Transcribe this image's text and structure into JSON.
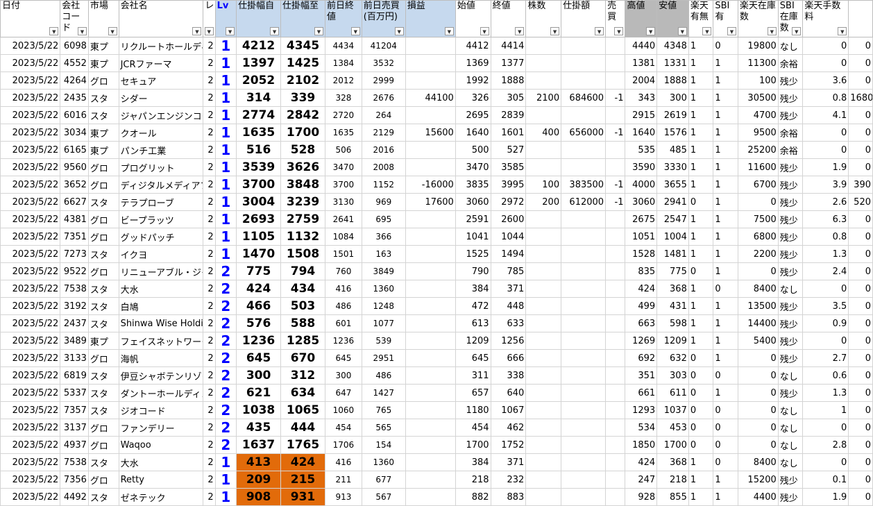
{
  "headers": [
    "日付",
    "会社コード",
    "市場",
    "会社名",
    "レ",
    "Lv",
    "仕掛幅自",
    "仕掛幅至",
    "前日終値",
    "前日売買(百万円)",
    "損益",
    "始値",
    "終値",
    "株数",
    "仕掛額",
    "売買",
    "高値",
    "安値",
    "楽天有無",
    "SBI有",
    "楽天在庫数",
    "SBI在庫数",
    "楽天手数料",
    ""
  ],
  "highlight": {
    "blue": [
      5,
      6,
      7,
      8,
      9,
      10
    ],
    "grey": [
      16,
      17
    ]
  },
  "colors": {
    "lv": "#0000ff",
    "orange": "#e26b0a",
    "header_blue": "#c6d9ee",
    "header_grey": "#b9b9b9",
    "grid": "#d4d4d4"
  },
  "rows": [
    [
      "2023/5/22",
      "6098",
      "東プ",
      "リクルートホールディングス",
      "2",
      "1",
      "4212",
      "4345",
      "4434",
      "41204",
      "",
      "4412",
      "4414",
      "",
      "",
      "",
      "4440",
      "4348",
      "1",
      "0",
      "19800",
      "なし",
      "0",
      "0"
    ],
    [
      "2023/5/22",
      "4552",
      "東プ",
      "JCRファーマ",
      "2",
      "1",
      "1397",
      "1425",
      "1384",
      "3532",
      "",
      "1369",
      "1377",
      "",
      "",
      "",
      "1381",
      "1331",
      "1",
      "1",
      "11300",
      "余裕",
      "0",
      "0"
    ],
    [
      "2023/5/22",
      "4264",
      "グロ",
      "セキュア",
      "2",
      "1",
      "2052",
      "2102",
      "2012",
      "2999",
      "",
      "1992",
      "1888",
      "",
      "",
      "",
      "2004",
      "1888",
      "1",
      "1",
      "100",
      "残少",
      "3.6",
      "0"
    ],
    [
      "2023/5/22",
      "2435",
      "スタ",
      "シダー",
      "2",
      "1",
      "314",
      "339",
      "328",
      "2676",
      "44100",
      "326",
      "305",
      "2100",
      "684600",
      "-1",
      "343",
      "300",
      "1",
      "1",
      "30500",
      "残少",
      "0.8",
      "1680"
    ],
    [
      "2023/5/22",
      "6016",
      "スタ",
      "ジャパンエンジンコーポレーション",
      "2",
      "1",
      "2774",
      "2842",
      "2720",
      "264",
      "",
      "2695",
      "2839",
      "",
      "",
      "",
      "2915",
      "2619",
      "1",
      "1",
      "4700",
      "残少",
      "4.1",
      "0"
    ],
    [
      "2023/5/22",
      "3034",
      "東プ",
      "クオール",
      "2",
      "1",
      "1635",
      "1700",
      "1635",
      "2129",
      "15600",
      "1640",
      "1601",
      "400",
      "656000",
      "-1",
      "1640",
      "1576",
      "1",
      "1",
      "9500",
      "余裕",
      "0",
      "0"
    ],
    [
      "2023/5/22",
      "6165",
      "東プ",
      "パンチ工業",
      "2",
      "1",
      "516",
      "528",
      "506",
      "2016",
      "",
      "500",
      "527",
      "",
      "",
      "",
      "535",
      "485",
      "1",
      "1",
      "25200",
      "余裕",
      "0",
      "0"
    ],
    [
      "2023/5/22",
      "9560",
      "グロ",
      "プログリット",
      "2",
      "1",
      "3539",
      "3626",
      "3470",
      "2008",
      "",
      "3470",
      "3585",
      "",
      "",
      "",
      "3590",
      "3330",
      "1",
      "1",
      "11600",
      "残少",
      "1.9",
      "0"
    ],
    [
      "2023/5/22",
      "3652",
      "グロ",
      "ディジタルメディアプロフェッショナル",
      "2",
      "1",
      "3700",
      "3848",
      "3700",
      "1152",
      "-16000",
      "3835",
      "3995",
      "100",
      "383500",
      "-1",
      "4000",
      "3655",
      "1",
      "1",
      "6700",
      "残少",
      "3.9",
      "390"
    ],
    [
      "2023/5/22",
      "6627",
      "スタ",
      "テラプローブ",
      "2",
      "1",
      "3004",
      "3239",
      "3130",
      "969",
      "17600",
      "3060",
      "2972",
      "200",
      "612000",
      "-1",
      "3060",
      "2941",
      "0",
      "1",
      "0",
      "残少",
      "2.6",
      "520"
    ],
    [
      "2023/5/22",
      "4381",
      "グロ",
      "ビープラッツ",
      "2",
      "1",
      "2693",
      "2759",
      "2641",
      "695",
      "",
      "2591",
      "2600",
      "",
      "",
      "",
      "2675",
      "2547",
      "1",
      "1",
      "7500",
      "残少",
      "6.3",
      "0"
    ],
    [
      "2023/5/22",
      "7351",
      "グロ",
      "グッドパッチ",
      "2",
      "1",
      "1105",
      "1132",
      "1084",
      "366",
      "",
      "1041",
      "1044",
      "",
      "",
      "",
      "1051",
      "1004",
      "1",
      "1",
      "6800",
      "残少",
      "0.8",
      "0"
    ],
    [
      "2023/5/22",
      "7273",
      "スタ",
      "イクヨ",
      "2",
      "1",
      "1470",
      "1508",
      "1501",
      "163",
      "",
      "1525",
      "1494",
      "",
      "",
      "",
      "1528",
      "1481",
      "1",
      "1",
      "2200",
      "残少",
      "1.3",
      "0"
    ],
    [
      "2023/5/22",
      "9522",
      "グロ",
      "リニューアブル・ジャパン",
      "2",
      "2",
      "775",
      "794",
      "760",
      "3849",
      "",
      "790",
      "785",
      "",
      "",
      "",
      "835",
      "775",
      "0",
      "1",
      "0",
      "残少",
      "2.4",
      "0"
    ],
    [
      "2023/5/22",
      "7538",
      "スタ",
      "大水",
      "2",
      "2",
      "424",
      "434",
      "416",
      "1360",
      "",
      "384",
      "371",
      "",
      "",
      "",
      "424",
      "368",
      "1",
      "0",
      "8400",
      "なし",
      "0",
      "0"
    ],
    [
      "2023/5/22",
      "3192",
      "スタ",
      "白鳩",
      "2",
      "2",
      "466",
      "503",
      "486",
      "1248",
      "",
      "472",
      "448",
      "",
      "",
      "",
      "499",
      "431",
      "1",
      "1",
      "13500",
      "残少",
      "3.5",
      "0"
    ],
    [
      "2023/5/22",
      "2437",
      "スタ",
      "Shinwa Wise Holdings",
      "2",
      "2",
      "576",
      "588",
      "601",
      "1077",
      "",
      "613",
      "633",
      "",
      "",
      "",
      "663",
      "598",
      "1",
      "1",
      "14400",
      "残少",
      "0.9",
      "0"
    ],
    [
      "2023/5/22",
      "3489",
      "東プ",
      "フェイスネットワーク",
      "2",
      "2",
      "1236",
      "1285",
      "1236",
      "539",
      "",
      "1209",
      "1256",
      "",
      "",
      "",
      "1269",
      "1209",
      "1",
      "1",
      "5400",
      "残少",
      "0",
      "0"
    ],
    [
      "2023/5/22",
      "3133",
      "グロ",
      "海帆",
      "2",
      "2",
      "645",
      "670",
      "645",
      "2951",
      "",
      "645",
      "666",
      "",
      "",
      "",
      "692",
      "632",
      "0",
      "1",
      "0",
      "残少",
      "2.7",
      "0"
    ],
    [
      "2023/5/22",
      "6819",
      "スタ",
      "伊豆シャボテンリゾート",
      "2",
      "2",
      "300",
      "312",
      "300",
      "486",
      "",
      "311",
      "338",
      "",
      "",
      "",
      "351",
      "303",
      "0",
      "0",
      "0",
      "なし",
      "0.6",
      "0"
    ],
    [
      "2023/5/22",
      "5337",
      "スタ",
      "ダントーホールディングス",
      "2",
      "2",
      "621",
      "634",
      "647",
      "1427",
      "",
      "657",
      "640",
      "",
      "",
      "",
      "661",
      "611",
      "0",
      "1",
      "0",
      "残少",
      "1.3",
      "0"
    ],
    [
      "2023/5/22",
      "7357",
      "スタ",
      "ジオコード",
      "2",
      "2",
      "1038",
      "1065",
      "1060",
      "765",
      "",
      "1180",
      "1067",
      "",
      "",
      "",
      "1293",
      "1037",
      "0",
      "0",
      "0",
      "なし",
      "1",
      "0"
    ],
    [
      "2023/5/22",
      "3137",
      "グロ",
      "ファンデリー",
      "2",
      "2",
      "435",
      "444",
      "454",
      "565",
      "",
      "454",
      "462",
      "",
      "",
      "",
      "534",
      "453",
      "0",
      "0",
      "0",
      "なし",
      "0",
      "0"
    ],
    [
      "2023/5/22",
      "4937",
      "グロ",
      "Waqoo",
      "2",
      "2",
      "1637",
      "1765",
      "1706",
      "154",
      "",
      "1700",
      "1752",
      "",
      "",
      "",
      "1850",
      "1700",
      "0",
      "0",
      "0",
      "なし",
      "2.8",
      "0"
    ],
    [
      "2023/5/22",
      "7538",
      "スタ",
      "大水",
      "2",
      "1",
      "413",
      "424",
      "416",
      "1360",
      "",
      "384",
      "371",
      "",
      "",
      "",
      "424",
      "368",
      "1",
      "0",
      "8400",
      "なし",
      "0",
      "0"
    ],
    [
      "2023/5/22",
      "7356",
      "グロ",
      "Retty",
      "2",
      "1",
      "209",
      "215",
      "211",
      "677",
      "",
      "218",
      "232",
      "",
      "",
      "",
      "247",
      "218",
      "1",
      "1",
      "15200",
      "残少",
      "0.1",
      "0"
    ],
    [
      "2023/5/22",
      "4492",
      "スタ",
      "ゼネテック",
      "2",
      "1",
      "908",
      "931",
      "913",
      "567",
      "",
      "882",
      "883",
      "",
      "",
      "",
      "928",
      "855",
      "1",
      "1",
      "4400",
      "残少",
      "1.9",
      "0"
    ]
  ],
  "orange_rows": [
    24,
    25,
    26
  ]
}
